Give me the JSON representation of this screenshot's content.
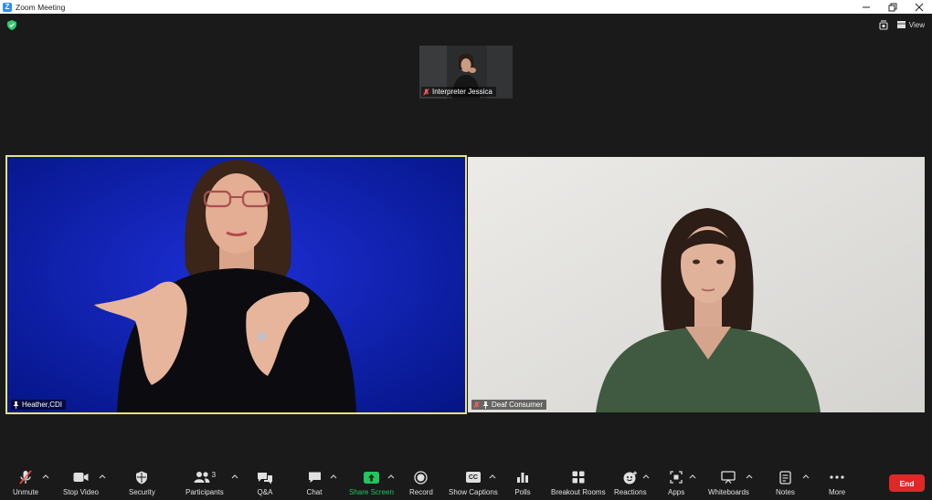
{
  "window": {
    "title": "Zoom Meeting",
    "app_icon_letter": "Z"
  },
  "topbar": {
    "view_label": "View"
  },
  "participants": [
    {
      "name": "Interpreter Jessica",
      "muted": true
    },
    {
      "name": "Heather,CDI",
      "muted": false,
      "pinned": true,
      "active_speaker": true
    },
    {
      "name": "Deaf Consumer",
      "muted": true,
      "pinned": true
    }
  ],
  "toolbar": {
    "unmute": "Unmute",
    "stop_video": "Stop Video",
    "security": "Security",
    "participants": "Participants",
    "participants_count": "3",
    "qa": "Q&A",
    "chat": "Chat",
    "share_screen": "Share Screen",
    "record": "Record",
    "show_captions": "Show Captions",
    "captions_badge": "CC",
    "polls": "Polls",
    "breakout_rooms": "Breakout Rooms",
    "reactions": "Reactions",
    "apps": "Apps",
    "whiteboards": "Whiteboards",
    "notes": "Notes",
    "more": "More",
    "end": "End"
  },
  "colors": {
    "share_green": "#22c55e",
    "end_red": "#e02828",
    "active_border": "#e6e47a",
    "shield_green": "#2ecc71"
  }
}
